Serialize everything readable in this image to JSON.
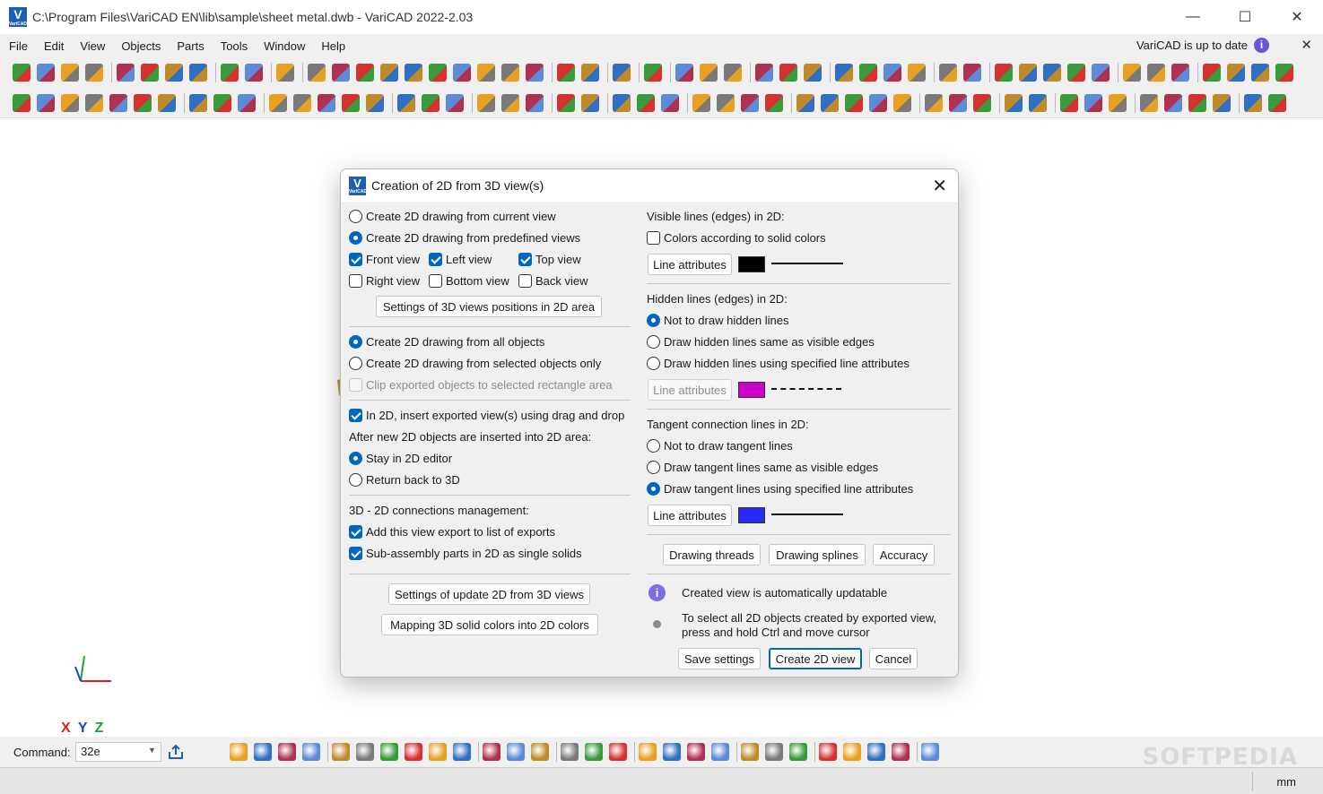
{
  "window": {
    "title": "C:\\Program Files\\VariCAD EN\\lib\\sample\\sheet metal.dwb - VariCAD 2022-2.03",
    "logo_text": "V",
    "logo_sub": "VariCAD",
    "minimize": "—",
    "maximize": "☐",
    "close": "✕"
  },
  "menu": {
    "items": [
      "File",
      "Edit",
      "View",
      "Objects",
      "Parts",
      "Tools",
      "Window",
      "Help"
    ],
    "update_status": "VariCAD is up to date",
    "info_glyph": "i",
    "close_glyph": "✕"
  },
  "canvas": {
    "axis_x": "X",
    "axis_y": "Y",
    "axis_z": "Z"
  },
  "command": {
    "label": "Command:",
    "value": "32e",
    "dropdown_glyph": "▼"
  },
  "status": {
    "units": "mm",
    "watermark": "SOFTPEDIA"
  },
  "dialog": {
    "title": "Creation of 2D from 3D view(s)",
    "logo_text": "V",
    "logo_sub": "VariCAD",
    "close_glyph": "✕",
    "left": {
      "create_current_view": "Create 2D drawing from current view",
      "create_predefined_views": "Create 2D drawing from predefined views",
      "front_view": "Front view",
      "left_view": "Left view",
      "top_view": "Top view",
      "right_view": "Right view",
      "bottom_view": "Bottom view",
      "back_view": "Back view",
      "settings_positions_button": "Settings of 3D views positions in 2D area",
      "create_all_objects": "Create 2D drawing from all objects",
      "create_selected_objects": "Create 2D drawing from selected objects only",
      "clip_exported_objects": "Clip exported objects to selected rectangle area",
      "insert_drag_drop": "In 2D, insert exported view(s) using drag and drop",
      "after_insert_label": "After new 2D objects are inserted into 2D area:",
      "stay_in_2d": "Stay in 2D editor",
      "return_to_3d": "Return back to 3D",
      "connections_label": "3D - 2D connections management:",
      "add_to_exports": "Add this view export to list of exports",
      "subassembly_single": "Sub-assembly parts in 2D as single solids",
      "settings_update_button": "Settings of update 2D from 3D views",
      "mapping_colors_button": "Mapping 3D solid colors into 2D colors"
    },
    "right": {
      "visible_lines_label": "Visible lines (edges) in 2D:",
      "colors_solid": "Colors according to solid colors",
      "visible_line_attr_button": "Line attributes",
      "visible_color": "#000000",
      "hidden_lines_label": "Hidden lines (edges) in 2D:",
      "hidden_not_draw": "Not to draw hidden lines",
      "hidden_same_visible": "Draw hidden lines same as visible edges",
      "hidden_specified": "Draw hidden lines using specified line attributes",
      "hidden_line_attr_button": "Line attributes",
      "hidden_color": "#cc00cc",
      "tangent_lines_label": "Tangent connection lines in 2D:",
      "tangent_not_draw": "Not to draw tangent lines",
      "tangent_same_visible": "Draw tangent lines same as visible edges",
      "tangent_specified": "Draw tangent lines using specified line attributes",
      "tangent_line_attr_button": "Line attributes",
      "tangent_color": "#2a2af5",
      "drawing_threads_button": "Drawing threads",
      "drawing_splines_button": "Drawing splines",
      "accuracy_button": "Accuracy",
      "info_glyph": "i",
      "info_updatable": "Created view is automatically updatable",
      "info_select_line1": "To select all 2D objects created by exported view,",
      "info_select_line2": "press and hold Ctrl and move cursor",
      "save_settings_button": "Save settings",
      "create_2d_view_button": "Create 2D view",
      "cancel_button": "Cancel"
    }
  }
}
